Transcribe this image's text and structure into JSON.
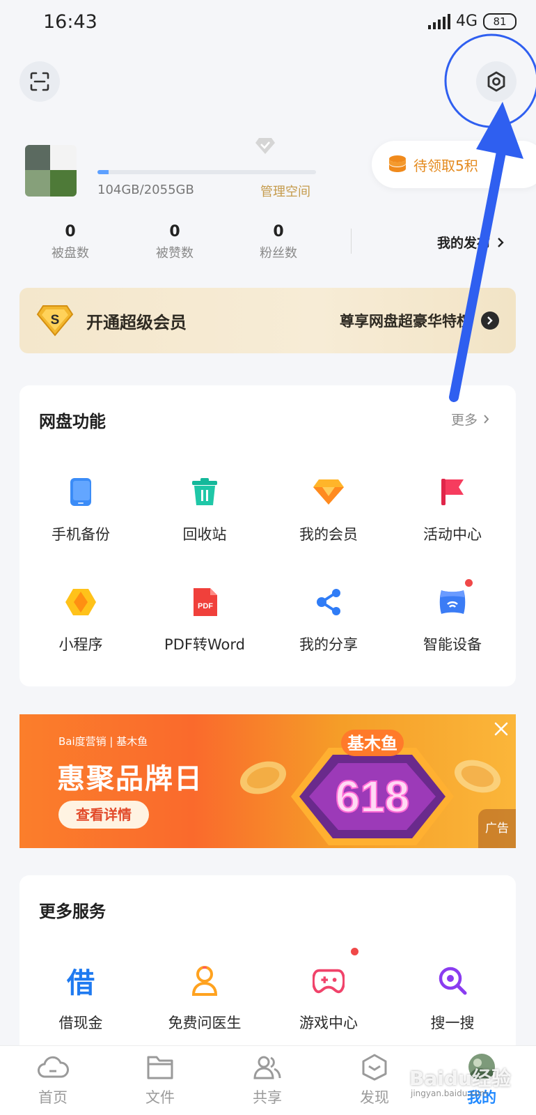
{
  "status": {
    "time": "16:43",
    "network": "4G",
    "battery": "81"
  },
  "profile": {
    "storage_used": "104GB/2055GB",
    "storage_fraction": 0.05,
    "manage_space": "管理空间",
    "points_pill": "待领取5积"
  },
  "stats": [
    {
      "value": "0",
      "label": "被盘数"
    },
    {
      "value": "0",
      "label": "被赞数"
    },
    {
      "value": "0",
      "label": "粉丝数"
    }
  ],
  "my_post": "我的发布",
  "vip": {
    "title": "开通超级会员",
    "subtitle": "尊享网盘超豪华特权",
    "badge": "S"
  },
  "features": {
    "title": "网盘功能",
    "more": "更多",
    "items": [
      {
        "label": "手机备份",
        "icon": "phone-backup-icon"
      },
      {
        "label": "回收站",
        "icon": "recycle-bin-icon"
      },
      {
        "label": "我的会员",
        "icon": "vip-diamond-icon"
      },
      {
        "label": "活动中心",
        "icon": "flag-icon"
      },
      {
        "label": "小程序",
        "icon": "mini-program-icon"
      },
      {
        "label": "PDF转Word",
        "icon": "pdf-icon"
      },
      {
        "label": "我的分享",
        "icon": "share-icon"
      },
      {
        "label": "智能设备",
        "icon": "smart-device-icon"
      }
    ]
  },
  "ad": {
    "brand": "Bai度营销 | 基木鱼",
    "title": "惠聚品牌日",
    "button": "查看详情",
    "badge_top": "基木鱼",
    "badge_num": "618",
    "tag": "广告"
  },
  "more_services": {
    "title": "更多服务",
    "items": [
      {
        "label": "借现金",
        "glyph": "借"
      },
      {
        "label": "免费问医生",
        "icon": "doctor-icon"
      },
      {
        "label": "游戏中心",
        "icon": "gamepad-icon"
      },
      {
        "label": "搜一搜",
        "icon": "search-icon"
      }
    ]
  },
  "tabs": [
    {
      "label": "首页",
      "icon": "cloud-icon"
    },
    {
      "label": "文件",
      "icon": "folder-icon"
    },
    {
      "label": "共享",
      "icon": "users-icon"
    },
    {
      "label": "发现",
      "icon": "discover-icon"
    },
    {
      "label": "我的",
      "icon": "avatar-icon"
    }
  ],
  "watermark": {
    "main": "Baidu经验",
    "sub": "jingyan.baidu.com"
  },
  "colors": {
    "accent": "#1f88ff",
    "annotation": "#2f5ff0",
    "gold": "#c59b4c",
    "points": "#e48a1e"
  }
}
